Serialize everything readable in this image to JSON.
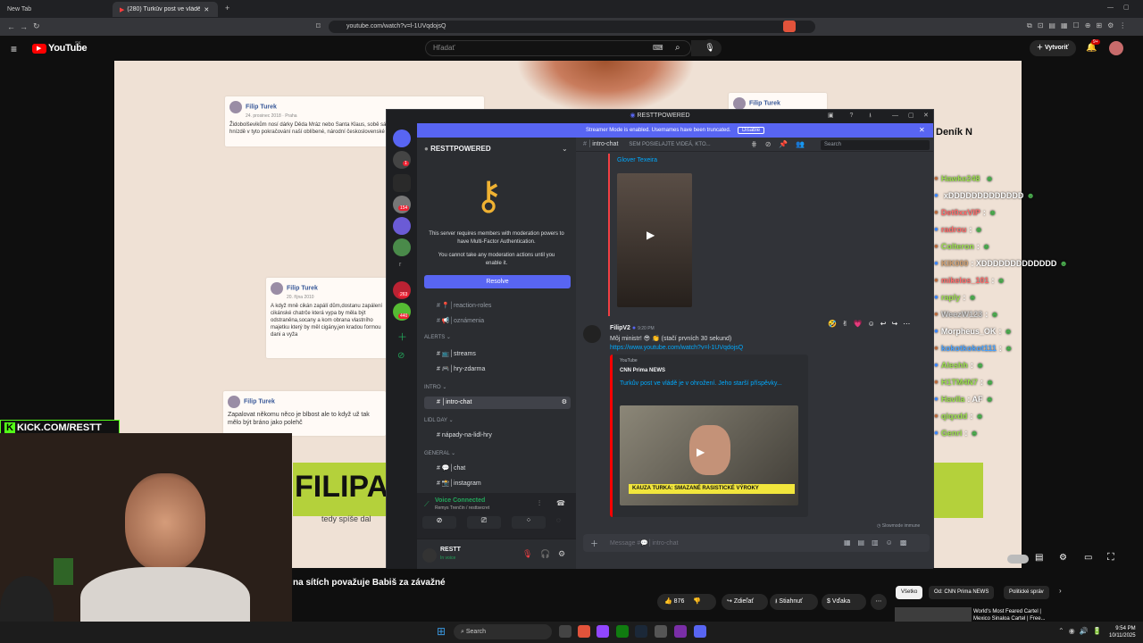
{
  "browser": {
    "tabs": [
      {
        "label": "New Tab"
      },
      {
        "label": "(280) Turkův post ve vládě j..."
      }
    ],
    "url": "youtube.com/watch?v=l-1UVqdojsQ"
  },
  "youtube": {
    "logo": "YouTube",
    "country": "SK",
    "search_placeholder": "Hľadať",
    "create_label": "Vytvoriť",
    "notif_count": "9+",
    "video_title": "na sítích považuje Babiš za závažné",
    "like_count": "876",
    "share_label": "Zdieľať",
    "download_label": "Stiahnuť",
    "thanks_label": "Vďaka",
    "chips": [
      "Všetko",
      "Od: CNN Prima NEWS",
      "Politické správ"
    ],
    "rec_title_1": "World's Most Feared Cartel |",
    "rec_title_2": "Mexico Sinaloa Cartel | Free..."
  },
  "video": {
    "fb_posts": [
      {
        "name": "Filip Turek",
        "date": "24. prosinec 2018 · Praha",
        "text": "Židobolševikům nosí dárky Děda Mráz nebo Santa Klaus, sobě sám a nebo mi naklade Hitler ! V orlím hnízdě v tyto pokračování naší oblíbené, národní československé pohádky Popelku.."
      },
      {
        "name": "Filip Turek",
        "date": "20. října 2010",
        "text": "A když mně cikán zapálí dům,dostanu zapálení cikánské chatrče která vypa by měla být odstraněna,socany a kom obrana vlastního majetku který by měl cigány,jen kradou formou dani a vyža"
      },
      {
        "name": "Filip Turek",
        "date": "",
        "text": "Zapalovat někomu něco je blbost ale to když už tak mělo být bráno jako polehč"
      },
      {
        "name": "Filip Turek",
        "date": "",
        "text": ""
      }
    ],
    "kick_overlay": "KICK.COM/RESTT",
    "news_brand": "Deník N",
    "banner_text": "FILIPA T",
    "banner_sub": "tedy spíše dal",
    "chat_lines": [
      {
        "user": "Hawke248",
        "msg": "",
        "color": "#9be04d"
      },
      {
        "user": "",
        "msg": "xDDDDDDDDDDDDD",
        "color": "#ffffff"
      },
      {
        "user": "Det0xxVIP",
        "msg": ":",
        "color": "#ff6b6b"
      },
      {
        "user": "radrou",
        "msg": ":",
        "color": "#ff6b6b"
      },
      {
        "user": "Colteron",
        "msg": ":",
        "color": "#9be04d"
      },
      {
        "user": "KIK000",
        "msg": ": XDDDDDDDDDDDDD",
        "color": "#d4a373"
      },
      {
        "user": "mikelos_101",
        "msg": ":",
        "color": "#ff6b6b"
      },
      {
        "user": "raply",
        "msg": ":",
        "color": "#9be04d"
      },
      {
        "user": "WeezW123",
        "msg": ":",
        "color": "#cfcfcf"
      },
      {
        "user": "Morpheus_OK",
        "msg": ":",
        "color": "#ffffff"
      },
      {
        "user": "kokotkokot111",
        "msg": ":",
        "color": "#4aa3ff"
      },
      {
        "user": "Aleshh",
        "msg": ":",
        "color": "#9be04d"
      },
      {
        "user": "H1TM4N7",
        "msg": ":",
        "color": "#9be04d"
      },
      {
        "user": "Havlla",
        "msg": ": AF",
        "color": "#9be04d"
      },
      {
        "user": "qiqxdd",
        "msg": ":",
        "color": "#9be04d"
      },
      {
        "user": "Genri",
        "msg": ":",
        "color": "#9be04d"
      }
    ],
    "time": "9:54 PM",
    "date": "10/11/2025"
  },
  "discord": {
    "window_title": "RESTTPOWERED",
    "banner_text": "Streamer Mode is enabled. Usernames have been truncated.",
    "banner_disable": "Disable",
    "server_name": "RESTTPOWERED",
    "mfa_text_1": "This server requires members with moderation powers to have Multi-Factor Authentication.",
    "mfa_text_2": "You cannot take any moderation actions until you enable it.",
    "resolve_label": "Resolve",
    "channels": [
      {
        "name": "reaction-roles",
        "prefix": "📍│"
      },
      {
        "name": "oznámenia",
        "prefix": "📢│"
      }
    ],
    "cat_alerts": "ALERTS",
    "alerts_channels": [
      {
        "name": "streams",
        "prefix": "📺│"
      },
      {
        "name": "hry-zdarma",
        "prefix": "🎮│"
      }
    ],
    "cat_intro": "INTRO",
    "intro_channel": "intro-chat",
    "cat_lidl": "LIDL DAY",
    "lidl_channel": "nápady-na-lidl-hry",
    "cat_general": "GENERAL",
    "general_channels": [
      {
        "name": "chat",
        "prefix": "💬│"
      },
      {
        "name": "instagram",
        "prefix": "📸│"
      }
    ],
    "voice_status": "Voice Connected",
    "voice_server": "Remys Trenčín / resttsecret",
    "user_name": "RESTT",
    "user_status": "In voice",
    "header_channel": "intro-chat",
    "header_topic": "SEM POSIELAJTE VIDEÁ, KTO...",
    "header_search": "Search",
    "prev_message_link": "Glover Texeira",
    "message_author": "FilipV2",
    "message_time": "9:20 PM",
    "message_text": "Môj ministr! 😎 👏 (stačí prvních 30 sekund)",
    "message_link": "https://www.youtube.com/watch?v=l-1UVqdojsQ",
    "embed_provider": "YouTube",
    "embed_author": "CNN Prima NEWS",
    "embed_title": "Turkův post ve vládě je v ohrožení. Jeho starší příspěvky...",
    "embed_caption": "KAUZA TURKA: SMAZANÉ RASISTICKÉ VÝROKY",
    "slowmode": "Slowmode immune",
    "composer_placeholder": "Message #💬│intro-chat",
    "guild_badges": [
      "1",
      "154",
      "263",
      "440"
    ]
  },
  "taskbar": {
    "search_label": "Search"
  }
}
